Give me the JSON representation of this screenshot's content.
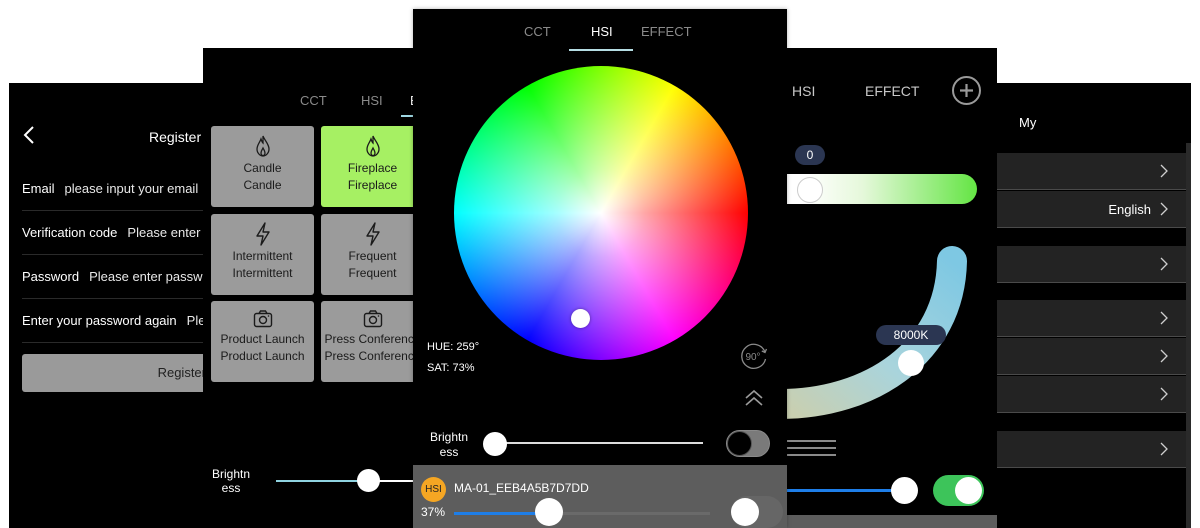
{
  "register_screen": {
    "title": "Register",
    "back_icon": "chevron-left-icon",
    "fields": [
      {
        "label": "Email",
        "placeholder": "please input your email"
      },
      {
        "label": "Verification code",
        "placeholder": "Please enter v"
      },
      {
        "label": "Password",
        "placeholder": "Please enter passwo"
      },
      {
        "label": "Enter your password again",
        "placeholder": "Plea"
      }
    ],
    "register_button": "Register"
  },
  "effect_screen": {
    "tabs": [
      "CCT",
      "HSI",
      "EFFECT"
    ],
    "active_tab": "EFFECT",
    "effects": [
      {
        "icon": "flame-icon",
        "name": "Candle",
        "subtitle": "Candle",
        "active": false
      },
      {
        "icon": "flame-icon",
        "name": "Fireplace",
        "subtitle": "Fireplace",
        "active": true
      },
      {
        "icon": "lightning-icon",
        "name": "Intermittent",
        "subtitle": "Intermittent",
        "active": false
      },
      {
        "icon": "lightning-icon",
        "name": "Frequent",
        "subtitle": "Frequent",
        "active": false
      },
      {
        "icon": "camera-icon",
        "name": "Product Launch",
        "subtitle": "Product Launch",
        "active": false
      },
      {
        "icon": "camera-icon",
        "name": "Press Conference",
        "subtitle": "Press Conference",
        "active": false
      }
    ],
    "brightness_label": "Brightn ess",
    "brightness_fraction": 0.6
  },
  "hsi_screen": {
    "tabs": [
      "CCT",
      "HSI",
      "EFFECT"
    ],
    "active_tab": "HSI",
    "hue_label": "HUE: 259°",
    "sat_label": "SAT: 73%",
    "hue_degrees": 259,
    "saturation_percent": 73,
    "rotate_button": "90°",
    "rotate_icon": "rotate-90-icon",
    "expand_icon": "double-chevron-up-icon",
    "brightness_label": "Brightn ess",
    "brightness_fraction": 0.0,
    "power_toggle_on": false,
    "device": {
      "mode_badge": "HSI",
      "name": "MA-01_EEB4A5B7D7DD",
      "brightness_label": "37%",
      "brightness_percent": 37
    },
    "colors": {
      "badge": "#f5a623",
      "slider": "#1e7ee8"
    }
  },
  "cct_screen": {
    "tabs": [
      "HSI",
      "EFFECT"
    ],
    "add_icon": "plus-circle-icon",
    "gm_value": "0",
    "cct_value": "8000K",
    "menu_icon": "hamburger-icon",
    "brightness_fraction": 0.9,
    "power_toggle_on": true,
    "colors": {
      "toggle_on": "#3dc45a",
      "arc": "#7ec8e3"
    }
  },
  "my_screen": {
    "title": "My",
    "rows": [
      {
        "value": ""
      },
      {
        "value": "English"
      },
      {
        "value": ""
      },
      {
        "value": ""
      },
      {
        "value": ""
      },
      {
        "value": ""
      },
      {
        "value": ""
      }
    ],
    "chevron_icon": "chevron-right-icon"
  }
}
